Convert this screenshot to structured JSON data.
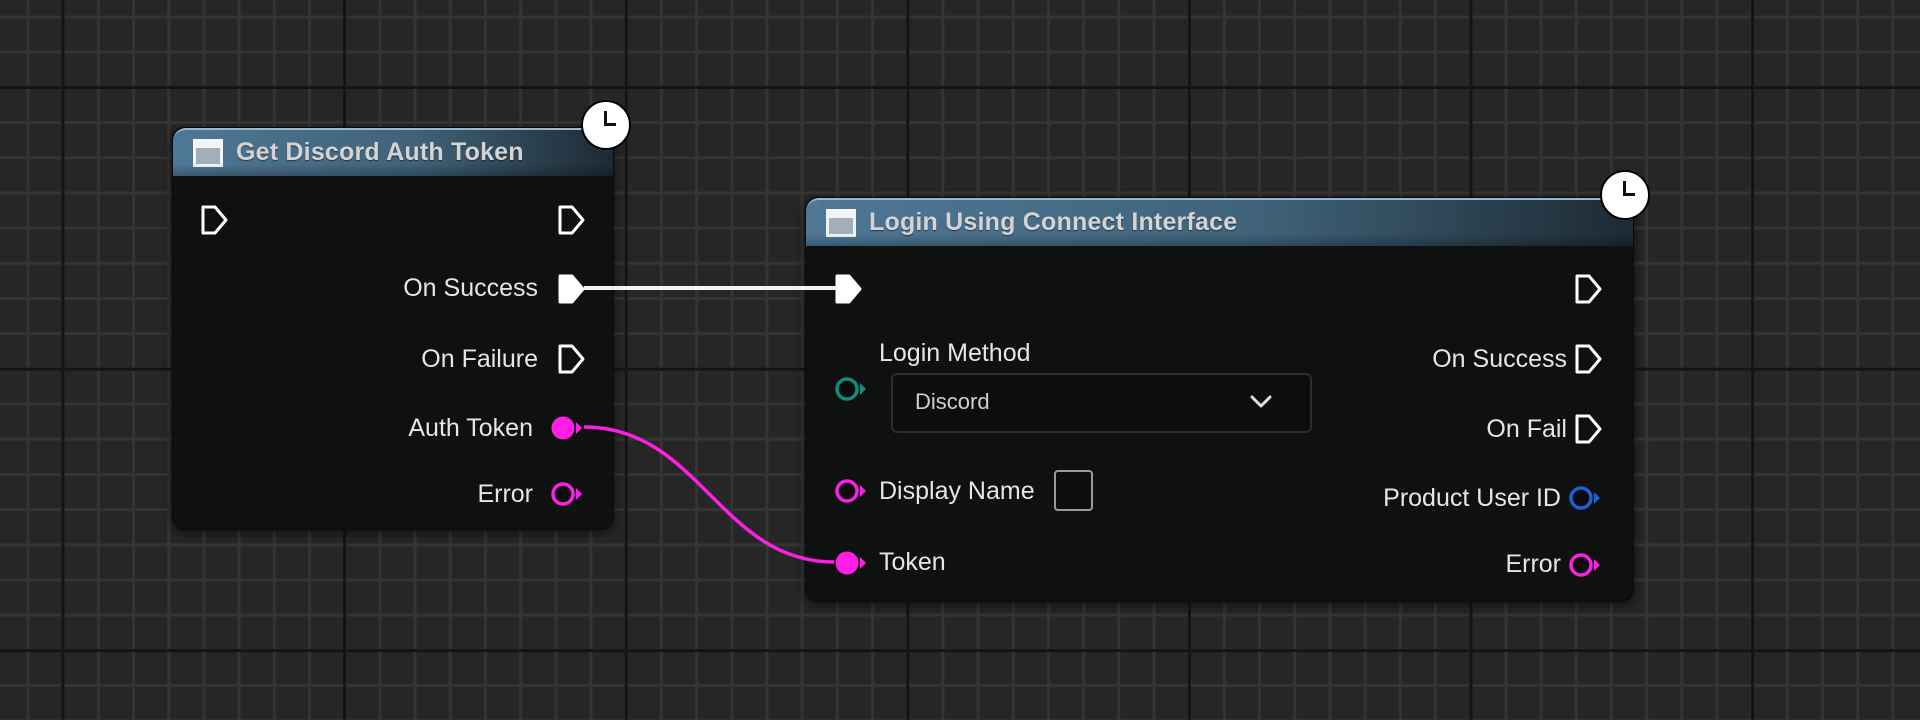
{
  "colors": {
    "exec": "#ffffff",
    "string_pin": "#ff1ee6",
    "enum_pin": "#0f8c7c",
    "struct_pin": "#1c5fd6",
    "header": "#4f7896"
  },
  "nodes": [
    {
      "id": "get-discord-auth-token",
      "title": "Get Discord Auth Token",
      "header_icon": "function-icon",
      "latent_icon": "clock-icon",
      "inputs": [
        {
          "type": "exec",
          "label": ""
        }
      ],
      "outputs": [
        {
          "type": "exec",
          "label": ""
        },
        {
          "type": "exec",
          "label": "On Success",
          "connected": true
        },
        {
          "type": "exec",
          "label": "On Failure"
        },
        {
          "type": "string",
          "label": "Auth Token",
          "connected": true
        },
        {
          "type": "string",
          "label": "Error"
        }
      ]
    },
    {
      "id": "login-using-connect-interface",
      "title": "Login Using Connect Interface",
      "header_icon": "function-icon",
      "latent_icon": "clock-icon",
      "inputs": [
        {
          "type": "exec",
          "label": "",
          "connected": true
        },
        {
          "type": "enum",
          "label": "Login Method",
          "value": "Discord"
        },
        {
          "type": "string",
          "label": "Display Name",
          "value": ""
        },
        {
          "type": "string",
          "label": "Token",
          "connected": true
        }
      ],
      "outputs": [
        {
          "type": "exec",
          "label": ""
        },
        {
          "type": "exec",
          "label": "On Success"
        },
        {
          "type": "exec",
          "label": "On Fail"
        },
        {
          "type": "struct",
          "label": "Product User ID"
        },
        {
          "type": "string",
          "label": "Error"
        }
      ]
    }
  ],
  "connections": [
    {
      "from": "Get Discord Auth Token.On Success",
      "to": "Login Using Connect Interface.exec",
      "type": "exec"
    },
    {
      "from": "Get Discord Auth Token.Auth Token",
      "to": "Login Using Connect Interface.Token",
      "type": "string"
    }
  ]
}
